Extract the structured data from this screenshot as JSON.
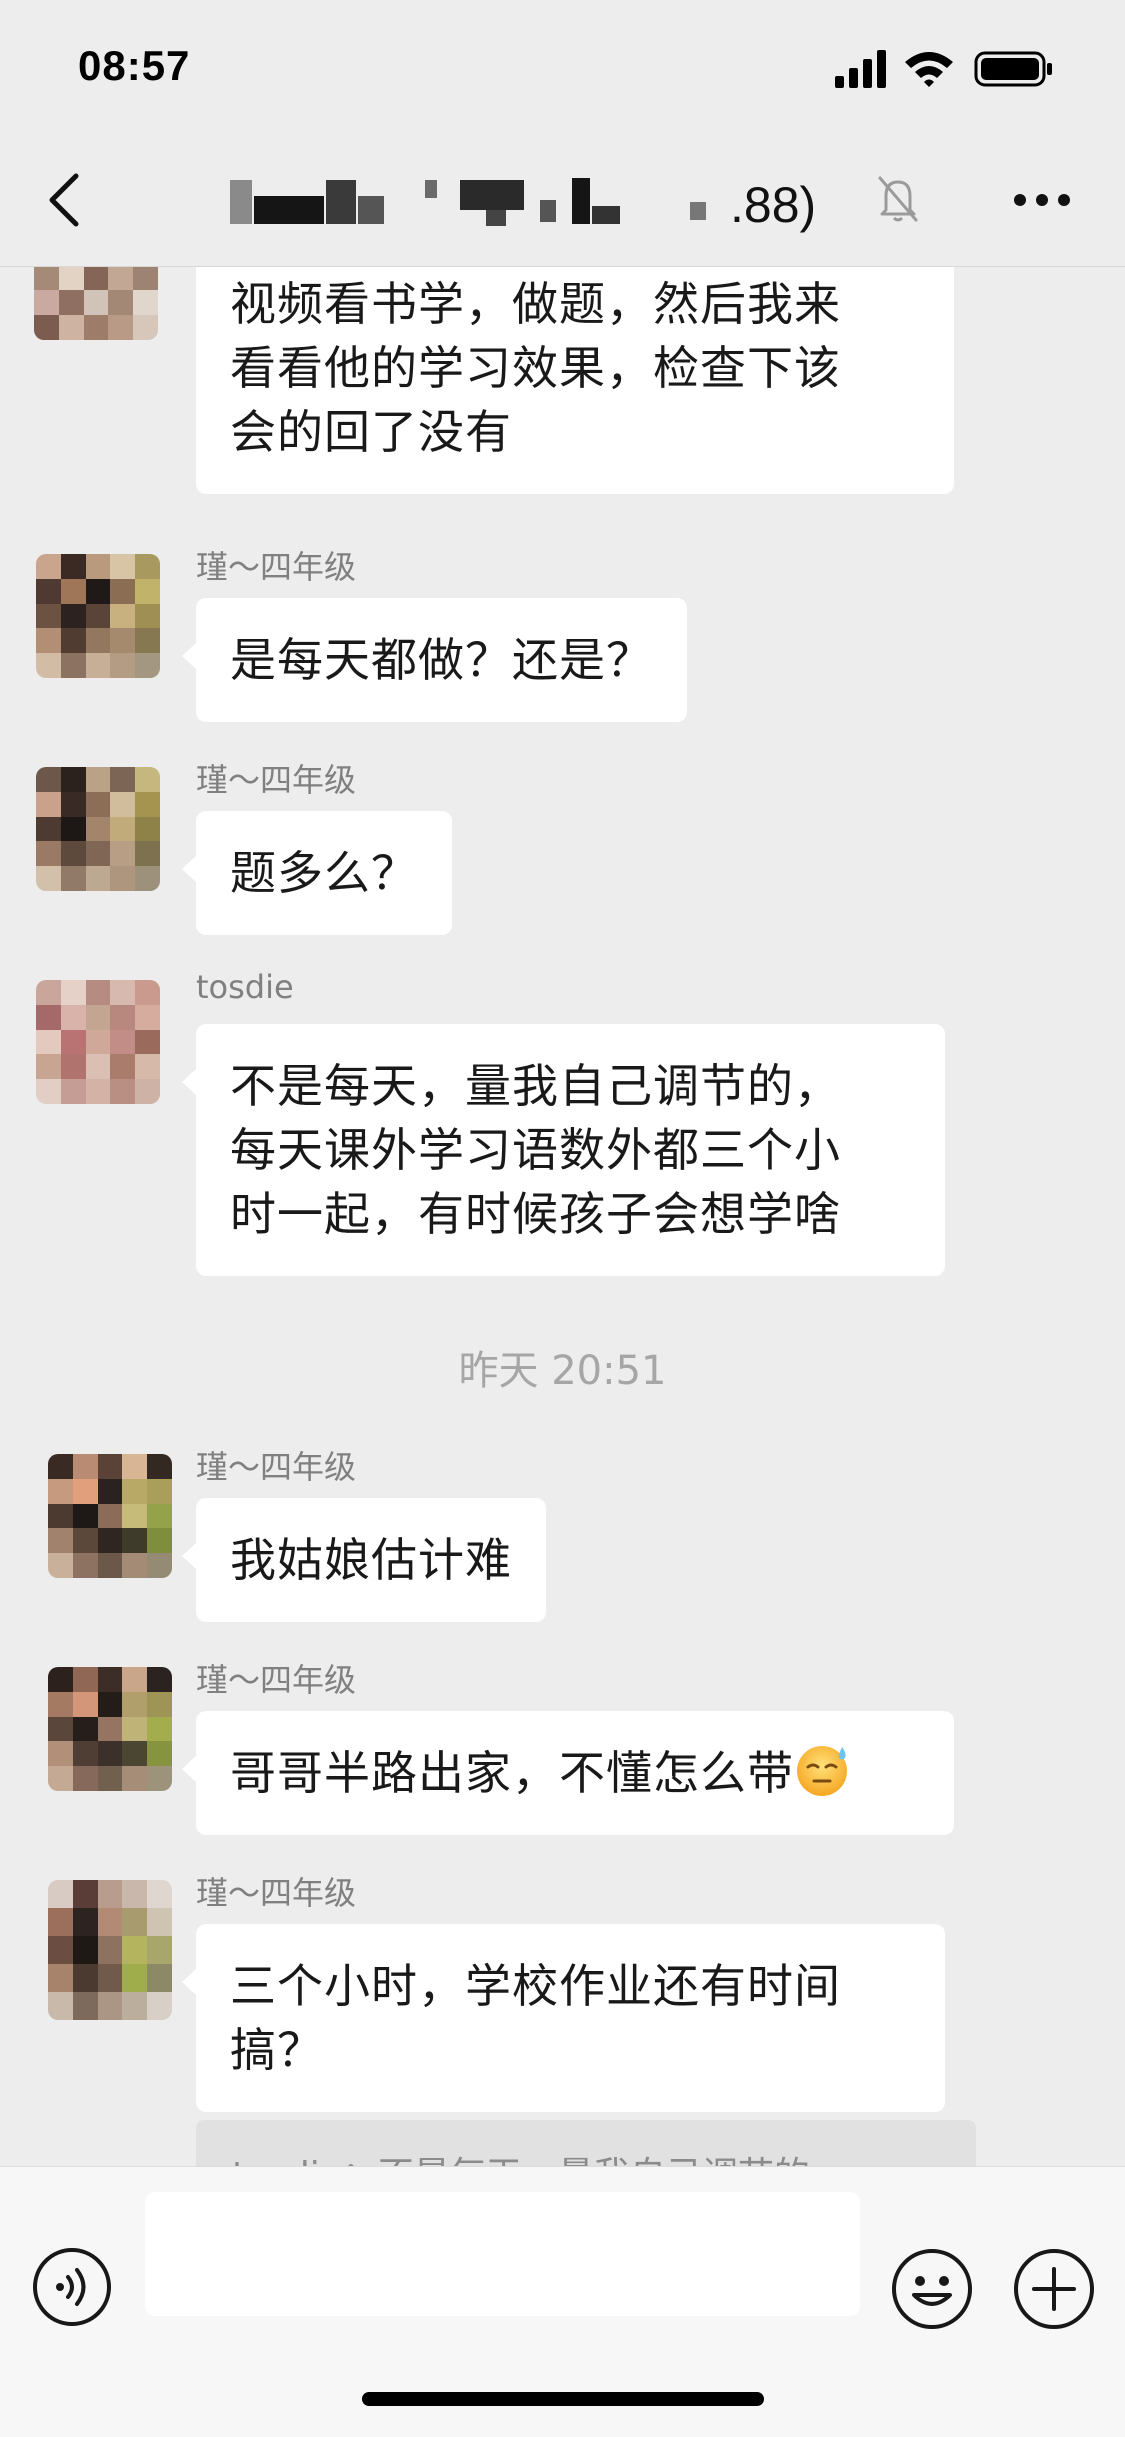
{
  "status_bar": {
    "time": "08:57",
    "icons": [
      "cellular-signal-icon",
      "wifi-icon",
      "battery-icon"
    ]
  },
  "nav": {
    "back_icon": "chevron-left-icon",
    "title_visible_suffix": ".88)",
    "mute_icon": "bell-muted-icon",
    "more_icon": "more-dots-icon"
  },
  "messages": [
    {
      "sender": "",
      "lines": [
        "视频看书学，做题，然后我来",
        "看看他的学习效果，检查下该",
        "会的回了没有"
      ]
    },
    {
      "sender": "瑾～四年级",
      "lines": [
        "是每天都做？还是？"
      ]
    },
    {
      "sender": "瑾～四年级",
      "lines": [
        "题多么？"
      ]
    },
    {
      "sender": "tosdie",
      "lines": [
        "不是每天，量我自己调节的，",
        "每天课外学习语数外都三个小",
        "时一起，有时候孩子会想学啥"
      ]
    },
    {
      "sender": "瑾～四年级",
      "lines": [
        "我姑娘估计难"
      ]
    },
    {
      "sender": "瑾～四年级",
      "lines": [
        "哥哥半路出家，不懂怎么带"
      ],
      "emoji": "sweat-smile-emoji"
    },
    {
      "sender": "瑾～四年级",
      "lines": [
        "三个小时，学校作业还有时间",
        "搞？"
      ]
    }
  ],
  "timestamp": "昨天 20:51",
  "quote": {
    "text": "tosdie：不是每天，量我自己调节的，"
  },
  "input_bar": {
    "voice_icon": "voice-icon",
    "input_placeholder": "",
    "emoji_icon": "emoji-face-icon",
    "plus_icon": "plus-circle-icon"
  },
  "colors": {
    "background": "#ededed",
    "bubble": "#ffffff",
    "sender_text": "#808080",
    "timestamp_text": "#a6a6a6"
  }
}
